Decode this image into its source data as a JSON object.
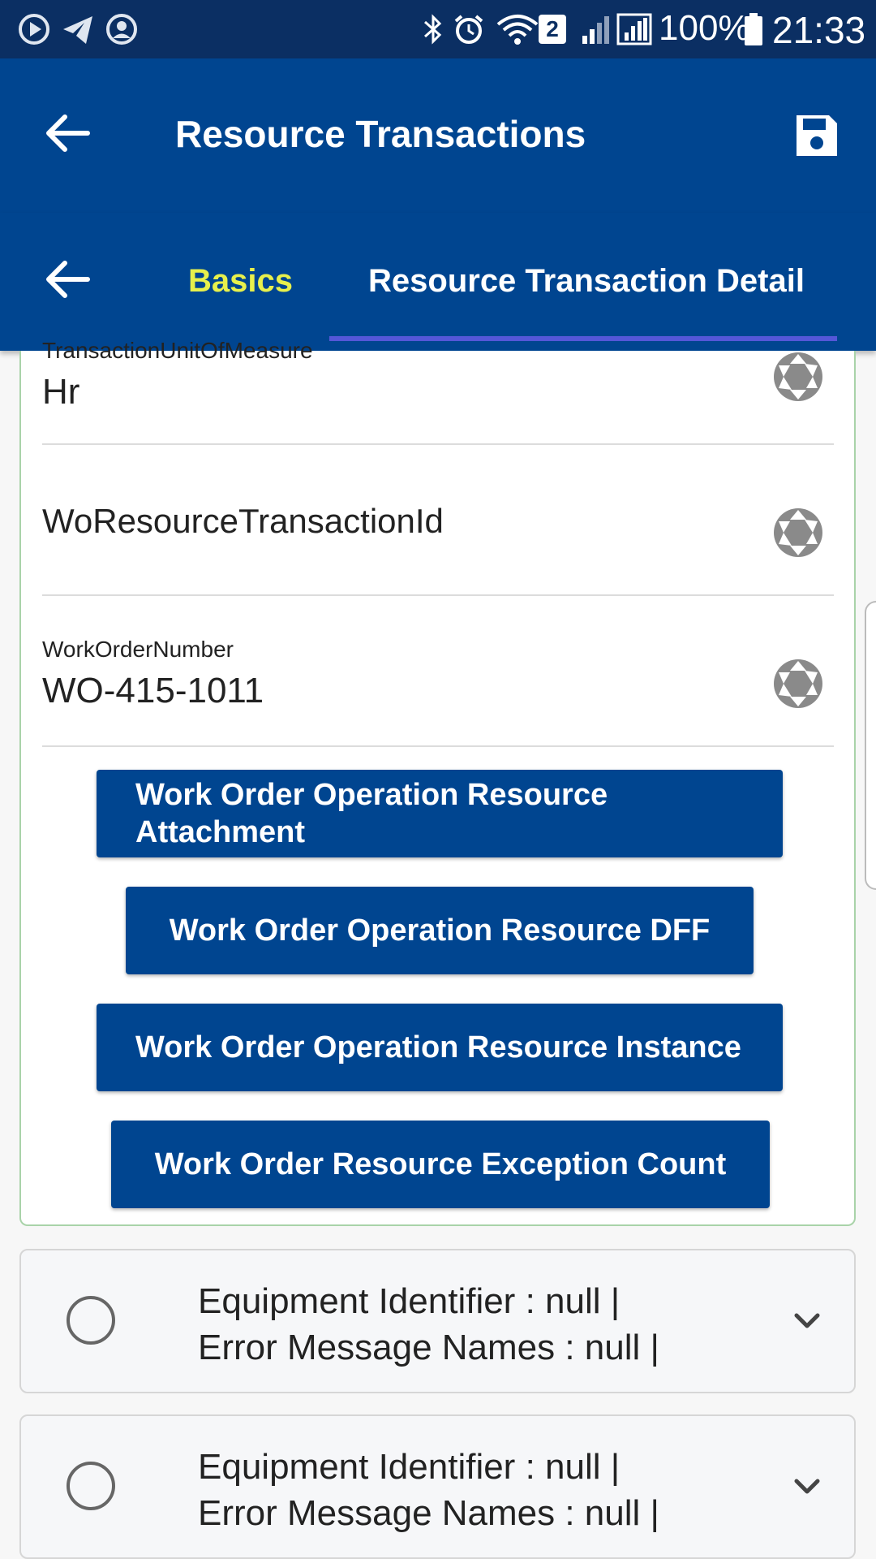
{
  "status_bar": {
    "battery_text": "100%",
    "time": "21:33",
    "sim_badge": "2"
  },
  "app_bar": {
    "title": "Resource Transactions",
    "back_icon": "arrow-left-icon",
    "save_icon": "save-icon"
  },
  "tabs": {
    "back_icon": "arrow-left-icon",
    "items": [
      {
        "label": "Basics",
        "active": false
      },
      {
        "label": "Resource Transaction Detail",
        "active": true
      }
    ]
  },
  "fields": [
    {
      "label": "TransactionUnitOfMeasure",
      "value": "Hr"
    },
    {
      "label": "",
      "value": "WoResourceTransactionId"
    },
    {
      "label": "WorkOrderNumber",
      "value": "WO-415-1011"
    }
  ],
  "action_buttons": [
    {
      "label": "Work Order Operation Resource Attachment"
    },
    {
      "label": "Work Order Operation Resource DFF"
    },
    {
      "label": "Work Order Operation Resource Instance"
    },
    {
      "label": "Work Order Resource Exception Count"
    }
  ],
  "list_items": [
    {
      "line1": "Equipment Identifier : null |",
      "line2": "Error Message Names : null |"
    },
    {
      "line1": "Equipment Identifier : null |",
      "line2": "Error Message Names : null |"
    }
  ],
  "colors": {
    "status_bar": "#0b2f63",
    "app_bar": "#004590",
    "tab_active_indicator": "#5557d8",
    "tab_basics_text": "#e7f04c",
    "button_bg": "#004590"
  }
}
